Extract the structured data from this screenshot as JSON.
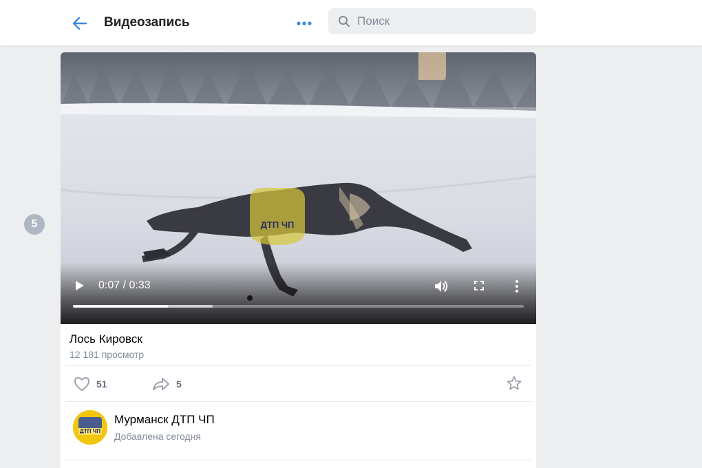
{
  "header": {
    "title": "Видеозапись",
    "search_placeholder": "Поиск"
  },
  "side_badge": "5",
  "player": {
    "time": "0:07 / 0:33",
    "watermark": "ДТП ЧП",
    "played_fraction": 0.21,
    "buffered_fraction": 0.31
  },
  "video": {
    "title": "Лось Кировск",
    "views": "12 181 просмотр",
    "likes": "51",
    "shares": "5"
  },
  "author": {
    "name": "Мурманск ДТП ЧП",
    "added": "Добавлена сегодня",
    "avatar_text": "ДТП ЧП"
  },
  "colors": {
    "accent": "#2a5885",
    "icon_blue": "#3f8ae0",
    "muted": "#818c99",
    "avatar_yellow": "#f2c50f"
  }
}
